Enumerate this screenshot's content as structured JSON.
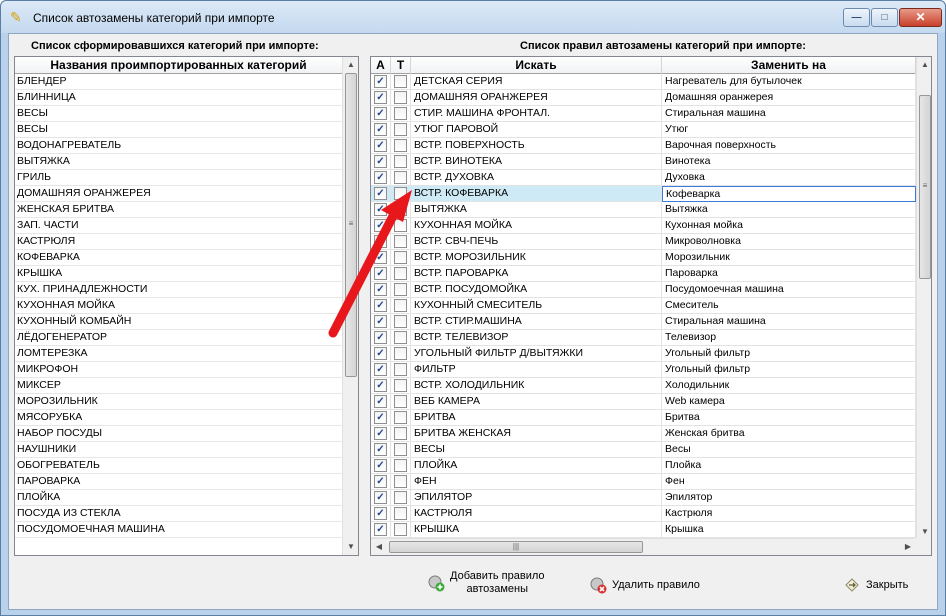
{
  "window": {
    "title": "Список автозамены категорий при импорте",
    "minimize_glyph": "—",
    "maximize_glyph": "□",
    "close_glyph": "✕"
  },
  "left": {
    "section_label": "Список сформировавшихся категорий при импорте:",
    "column_header": "Названия проимпортированных категорий",
    "items": [
      "БЛЕНДЕР",
      "БЛИННИЦА",
      "ВЕСЫ",
      "ВЕСЫ",
      "ВОДОНАГРЕВАТЕЛЬ",
      "ВЫТЯЖКА",
      "ГРИЛЬ",
      "ДОМАШНЯЯ ОРАНЖЕРЕЯ",
      "ЖЕНСКАЯ БРИТВА",
      "ЗАП. ЧАСТИ",
      "КАСТРЮЛЯ",
      "КОФЕВАРКА",
      "КРЫШКА",
      "КУХ. ПРИНАДЛЕЖНОСТИ",
      "КУХОННАЯ МОЙКА",
      "КУХОННЫЙ КОМБАЙН",
      "ЛЁДОГЕНЕРАТОР",
      "ЛОМТЕРЕЗКА",
      "МИКРОФОН",
      "МИКСЕР",
      "МОРОЗИЛЬНИК",
      "МЯСОРУБКА",
      "НАБОР ПОСУДЫ",
      "НАУШНИКИ",
      "ОБОГРЕВАТЕЛЬ",
      "ПАРОВАРКА",
      "ПЛОЙКА",
      "ПОСУДА ИЗ СТЕКЛА",
      "ПОСУДОМОЕЧНАЯ МАШИНА"
    ]
  },
  "right": {
    "section_label": "Список правил автозамены категорий при импорте:",
    "columns": {
      "a": "A",
      "t": "T",
      "search": "Искать",
      "replace": "Заменить на"
    },
    "check_glyph": "✓",
    "selected_row": 7,
    "rows": [
      {
        "a": true,
        "t": false,
        "search": "ДЕТСКАЯ СЕРИЯ",
        "replace": "Нагреватель для бутылочек"
      },
      {
        "a": true,
        "t": false,
        "search": "ДОМАШНЯЯ ОРАНЖЕРЕЯ",
        "replace": "Домашняя оранжерея"
      },
      {
        "a": true,
        "t": false,
        "search": "СТИР. МАШИНА ФРОНТАЛ.",
        "replace": "Стиральная машина"
      },
      {
        "a": true,
        "t": false,
        "search": "УТЮГ ПАРОВОЙ",
        "replace": "Утюг"
      },
      {
        "a": true,
        "t": false,
        "search": "ВСТР. ПОВЕРХНОСТЬ",
        "replace": "Варочная поверхность"
      },
      {
        "a": true,
        "t": false,
        "search": "ВСТР. ВИНОТЕКА",
        "replace": "Винотека"
      },
      {
        "a": true,
        "t": false,
        "search": "ВСТР. ДУХОВКА",
        "replace": "Духовка"
      },
      {
        "a": true,
        "t": false,
        "search": "ВСТР. КОФЕВАРКА",
        "replace": "Кофеварка"
      },
      {
        "a": true,
        "t": false,
        "search": "ВЫТЯЖКА",
        "replace": "Вытяжка"
      },
      {
        "a": true,
        "t": false,
        "search": "КУХОННАЯ МОЙКА",
        "replace": "Кухонная мойка"
      },
      {
        "a": true,
        "t": false,
        "search": "ВСТР. СВЧ-ПЕЧЬ",
        "replace": "Микроволновка"
      },
      {
        "a": true,
        "t": false,
        "search": "ВСТР. МОРОЗИЛЬНИК",
        "replace": "Морозильник"
      },
      {
        "a": true,
        "t": false,
        "search": "ВСТР. ПАРОВАРКА",
        "replace": "Пароварка"
      },
      {
        "a": true,
        "t": false,
        "search": "ВСТР. ПОСУДОМОЙКА",
        "replace": "Посудомоечная машина"
      },
      {
        "a": true,
        "t": false,
        "search": "КУХОННЫЙ СМЕСИТЕЛЬ",
        "replace": "Смеситель"
      },
      {
        "a": true,
        "t": false,
        "search": "ВСТР. СТИР.МАШИНА",
        "replace": "Стиральная машина"
      },
      {
        "a": true,
        "t": false,
        "search": "ВСТР. ТЕЛЕВИЗОР",
        "replace": "Телевизор"
      },
      {
        "a": true,
        "t": false,
        "search": "УГОЛЬНЫЙ ФИЛЬТР Д/ВЫТЯЖКИ",
        "replace": "Угольный фильтр"
      },
      {
        "a": true,
        "t": false,
        "search": "ФИЛЬТР",
        "replace": "Угольный фильтр"
      },
      {
        "a": true,
        "t": false,
        "search": "ВСТР. ХОЛОДИЛЬНИК",
        "replace": "Холодильник"
      },
      {
        "a": true,
        "t": false,
        "search": "ВЕБ КАМЕРА",
        "replace": "Web камера"
      },
      {
        "a": true,
        "t": false,
        "search": "БРИТВА",
        "replace": "Бритва"
      },
      {
        "a": true,
        "t": false,
        "search": "БРИТВА ЖЕНСКАЯ",
        "replace": "Женская бритва"
      },
      {
        "a": true,
        "t": false,
        "search": "ВЕСЫ",
        "replace": "Весы"
      },
      {
        "a": true,
        "t": false,
        "search": "ПЛОЙКА",
        "replace": "Плойка"
      },
      {
        "a": true,
        "t": false,
        "search": "ФЕН",
        "replace": "Фен"
      },
      {
        "a": true,
        "t": false,
        "search": "ЭПИЛЯТОР",
        "replace": "Эпилятор"
      },
      {
        "a": true,
        "t": false,
        "search": "КАСТРЮЛЯ",
        "replace": "Кастрюля"
      },
      {
        "a": true,
        "t": false,
        "search": "КРЫШКА",
        "replace": "Крышка"
      }
    ]
  },
  "buttons": {
    "add_line1": "Добавить правило",
    "add_line2": "автозамены",
    "delete": "Удалить правило",
    "close": "Закрыть"
  },
  "colors": {
    "annotation_arrow": "#e8171b",
    "selection": "#cfeaf7"
  }
}
